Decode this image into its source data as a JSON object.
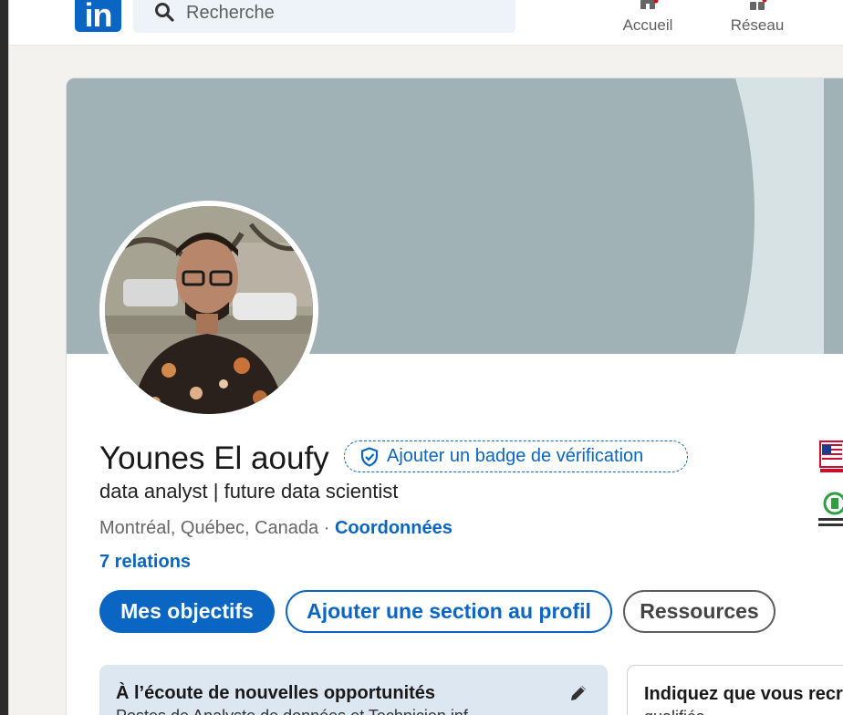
{
  "nav": {
    "search_placeholder": "Recherche",
    "items": [
      {
        "label": "Accueil",
        "icon": "home-icon"
      },
      {
        "label": "Réseau",
        "icon": "network-icon"
      }
    ]
  },
  "profile": {
    "name": "Younes El aoufy",
    "verification_badge": "Ajouter un badge de vérification",
    "headline": "data analyst | future data scientist",
    "location": "Montréal, Québec, Canada",
    "separator": "·",
    "contact_link": "Coordonnées",
    "connections": "7 relations"
  },
  "actions": {
    "primary": "Mes objectifs",
    "add_section": "Ajouter une section au profil",
    "resources": "Ressources"
  },
  "open_to_work": {
    "title": "À l’écoute de nouvelles opportunités",
    "subtitle": "Postes de Analyste de données et Technicien inf"
  },
  "recruiters": {
    "title": "Indiquez que vous recru",
    "subtitle": "qualifiés"
  },
  "colors": {
    "brand_blue": "#0a66c2",
    "banner": "#a0b2b5",
    "page_bg": "#f4f2ee",
    "open_to_work_bg": "#dde7f1"
  }
}
